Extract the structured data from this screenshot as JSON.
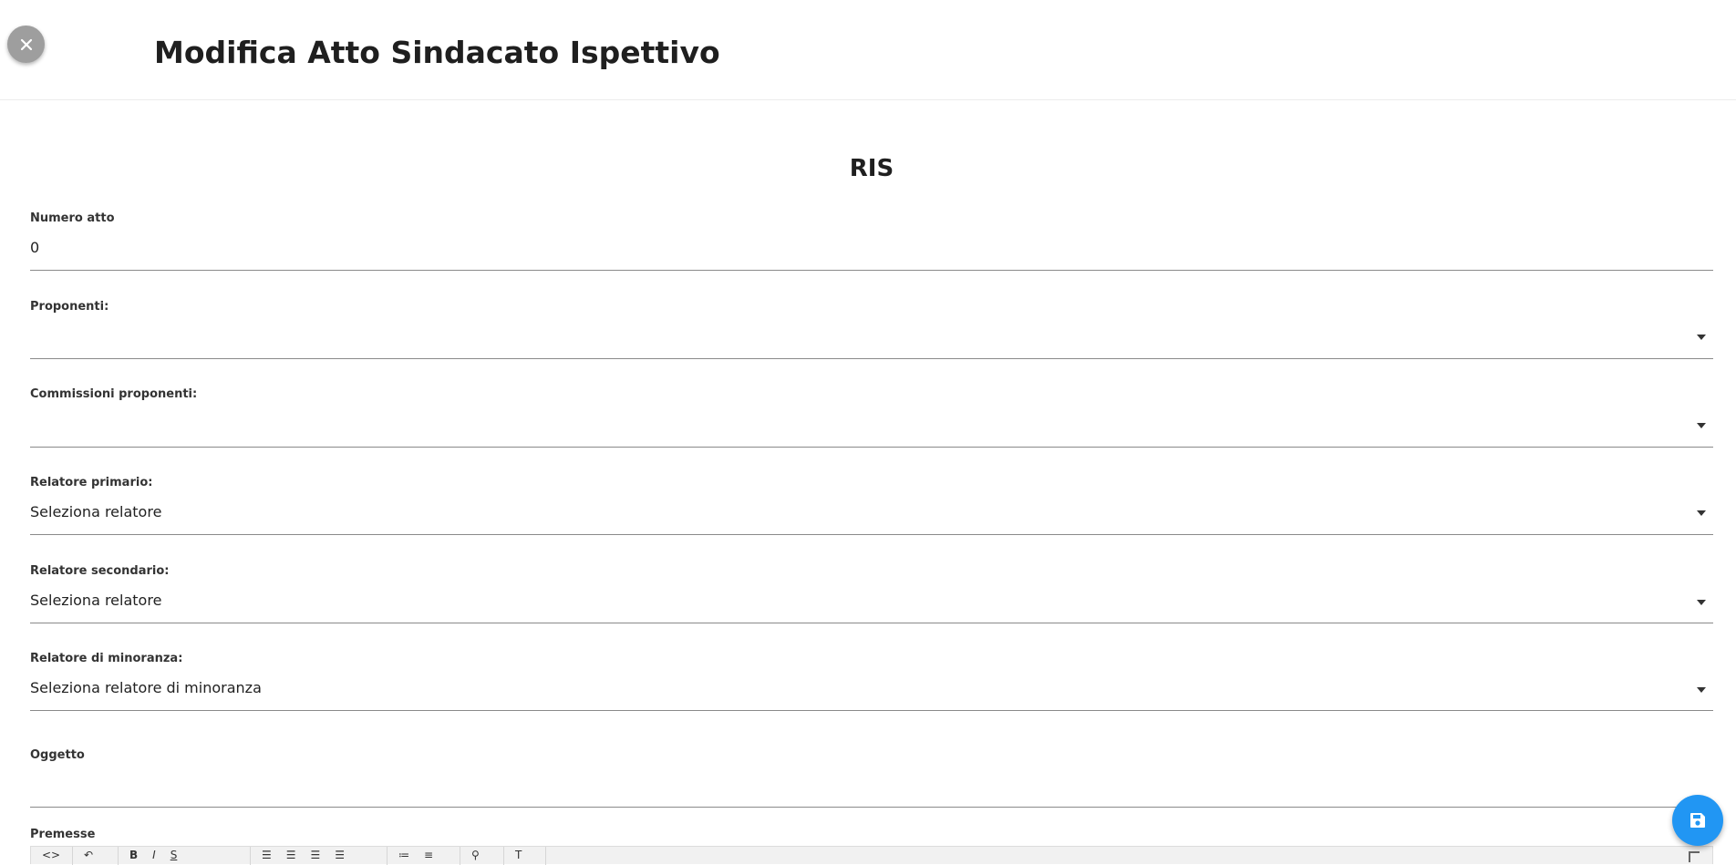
{
  "header": {
    "title": "Modifica Atto Sindacato Ispettivo",
    "close_icon": "close-icon"
  },
  "form": {
    "section_title": "RIS",
    "numero_atto": {
      "label": "Numero atto",
      "value": "0"
    },
    "proponenti": {
      "label": "Proponenti:",
      "value": ""
    },
    "commissioni": {
      "label": "Commissioni proponenti:",
      "value": ""
    },
    "relatore_primario": {
      "label": "Relatore primario:",
      "value": "Seleziona relatore"
    },
    "relatore_secondario": {
      "label": "Relatore secondario:",
      "value": "Seleziona relatore"
    },
    "relatore_minoranza": {
      "label": "Relatore di minoranza:",
      "value": "Seleziona relatore di minoranza"
    },
    "oggetto": {
      "label": "Oggetto",
      "value": ""
    },
    "premesse": {
      "label": "Premesse"
    }
  },
  "toolbar": {
    "groups": [
      [
        "code-view-icon",
        "undo-icon"
      ],
      [
        "bold-icon",
        "italic-icon",
        "underline-icon"
      ],
      [
        "align-left-icon",
        "align-center-icon",
        "align-right-icon",
        "align-justify-icon"
      ],
      [
        "bullet-list-icon",
        "numbered-list-icon"
      ],
      [
        "link-icon"
      ],
      [
        "text-format-icon"
      ]
    ],
    "expand_icon": "fullscreen-icon"
  },
  "fab": {
    "icon": "save-icon",
    "color": "#2196f3"
  },
  "colors": {
    "accent": "#2196f3",
    "close_button": "#9e9e9e"
  }
}
